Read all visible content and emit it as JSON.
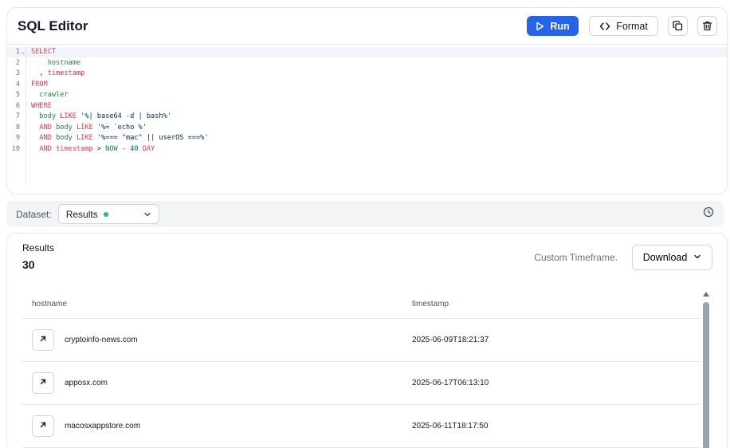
{
  "editor": {
    "title": "SQL Editor",
    "run_label": "Run",
    "format_label": "Format",
    "lines": [
      {
        "n": "1",
        "fold": true,
        "tokens": [
          {
            "t": "SELECT",
            "c": "kw"
          }
        ]
      },
      {
        "n": "2",
        "tokens": [
          {
            "t": "    hostname",
            "c": "id"
          }
        ]
      },
      {
        "n": "3",
        "tokens": [
          {
            "t": "  , ",
            "c": "plain"
          },
          {
            "t": "timestamp",
            "c": "kw"
          }
        ]
      },
      {
        "n": "4",
        "tokens": [
          {
            "t": "FROM",
            "c": "kw"
          }
        ]
      },
      {
        "n": "5",
        "tokens": [
          {
            "t": "  crawler",
            "c": "id"
          }
        ]
      },
      {
        "n": "6",
        "tokens": [
          {
            "t": "WHERE",
            "c": "kw"
          }
        ]
      },
      {
        "n": "7",
        "tokens": [
          {
            "t": "  body ",
            "c": "id"
          },
          {
            "t": "LIKE",
            "c": "kw"
          },
          {
            "t": " '%| base64 -d | bash%'",
            "c": "str"
          }
        ]
      },
      {
        "n": "8",
        "tokens": [
          {
            "t": "  ",
            "c": "plain"
          },
          {
            "t": "AND",
            "c": "kw"
          },
          {
            "t": " body ",
            "c": "id"
          },
          {
            "t": "LIKE",
            "c": "kw"
          },
          {
            "t": " '%= `echo %'",
            "c": "str"
          }
        ]
      },
      {
        "n": "9",
        "tokens": [
          {
            "t": "  ",
            "c": "plain"
          },
          {
            "t": "AND",
            "c": "kw"
          },
          {
            "t": " body ",
            "c": "id"
          },
          {
            "t": "LIKE",
            "c": "kw"
          },
          {
            "t": " '%=== \"mac\" || userOS ===%'",
            "c": "str"
          }
        ]
      },
      {
        "n": "10",
        "tokens": [
          {
            "t": "  ",
            "c": "plain"
          },
          {
            "t": "AND",
            "c": "kw"
          },
          {
            "t": " timestamp",
            "c": "kw"
          },
          {
            "t": " > ",
            "c": "plain"
          },
          {
            "t": "NOW",
            "c": "id"
          },
          {
            "t": " - ",
            "c": "plain"
          },
          {
            "t": "40",
            "c": "num"
          },
          {
            "t": " DAY",
            "c": "kw"
          }
        ]
      }
    ]
  },
  "dataset": {
    "label": "Dataset:",
    "selected": "Results",
    "status_color": "#22c55e"
  },
  "results": {
    "label": "Results",
    "count": "30",
    "timeframe": "Custom Timeframe.",
    "download_label": "Download",
    "columns": [
      "hostname",
      "timestamp"
    ],
    "rows": [
      {
        "hostname": "cryptoinfo-news.com",
        "timestamp": "2025-06-09T18:21:37"
      },
      {
        "hostname": "apposx.com",
        "timestamp": "2025-06-17T06:13:10"
      },
      {
        "hostname": "macosxappstore.com",
        "timestamp": "2025-06-11T18:17:50"
      }
    ]
  },
  "colors": {
    "accent": "#2563eb"
  },
  "icons": [
    "play-icon",
    "code-icon",
    "copy-icon",
    "trash-icon",
    "chevron-down-icon",
    "clock-icon",
    "arrow-up-right-icon"
  ]
}
